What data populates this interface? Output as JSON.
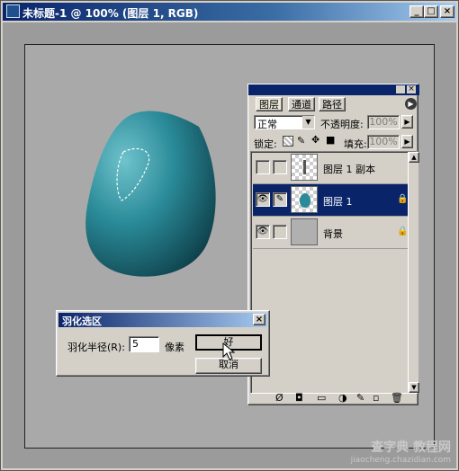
{
  "document": {
    "title": "未标题-1 @ 100% (图层 1, RGB)",
    "minimize": "_",
    "maximize": "□",
    "close": "×"
  },
  "layers_palette": {
    "tabs": [
      "图层",
      "通道",
      "路径"
    ],
    "blend_mode": "正常",
    "opacity_label": "不透明度:",
    "opacity_value": "100%",
    "lock_label": "锁定:",
    "fill_label": "填充:",
    "fill_value": "100%",
    "layers": [
      {
        "name": "图层 1 副本",
        "visible": false,
        "selected": false
      },
      {
        "name": "图层 1",
        "visible": true,
        "selected": true
      },
      {
        "name": "背景",
        "visible": true,
        "selected": false
      }
    ]
  },
  "feather_dialog": {
    "title": "羽化选区",
    "radius_label": "羽化半径(R):",
    "radius_value": "5",
    "unit": "像素",
    "ok_label": "好",
    "cancel_label": "取消",
    "close": "×"
  },
  "watermark": {
    "brand": "查字典 教程网",
    "url": "jiaocheng.chazidian.com"
  },
  "colors": {
    "title_active": "#0a246a",
    "shape_teal": "#2a8a98",
    "selected_row": "#0a246a"
  }
}
